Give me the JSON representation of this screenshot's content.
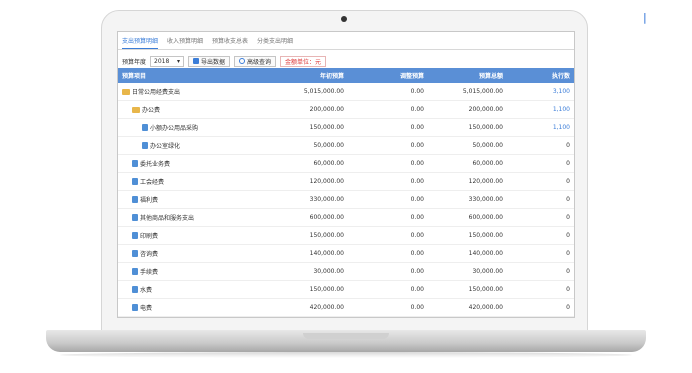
{
  "tabs": [
    "支出预算明细",
    "收入预算明细",
    "预算收支总表",
    "分类支出明细"
  ],
  "toolbar": {
    "year_label": "预算年度",
    "year_value": "2018",
    "export_label": "导出数据",
    "search_label": "高级查询",
    "unit_label": "金额单位：元"
  },
  "columns": [
    "预算项目",
    "年初预算",
    "调整预算",
    "预算总额",
    "执行数"
  ],
  "header_last": "执行数",
  "rows": [
    {
      "name": "日常公用经费支出",
      "icon": "folder-icon",
      "indent": 0,
      "v1": "5,015,000.00",
      "v2": "0.00",
      "v3": "5,015,000.00",
      "v4": "3,100"
    },
    {
      "name": "办公费",
      "icon": "folder-icon",
      "indent": 1,
      "v1": "200,000.00",
      "v2": "0.00",
      "v3": "200,000.00",
      "v4": "1,100"
    },
    {
      "name": "小额办公用品采购",
      "icon": "file-icon",
      "indent": 2,
      "v1": "150,000.00",
      "v2": "0.00",
      "v3": "150,000.00",
      "v4": "1,100"
    },
    {
      "name": "办公室绿化",
      "icon": "file-icon",
      "indent": 2,
      "v1": "50,000.00",
      "v2": "0.00",
      "v3": "50,000.00",
      "v4": "0"
    },
    {
      "name": "委托业务费",
      "icon": "file-icon",
      "indent": 1,
      "v1": "60,000.00",
      "v2": "0.00",
      "v3": "60,000.00",
      "v4": "0"
    },
    {
      "name": "工会经费",
      "icon": "file-icon",
      "indent": 1,
      "v1": "120,000.00",
      "v2": "0.00",
      "v3": "120,000.00",
      "v4": "0"
    },
    {
      "name": "福利费",
      "icon": "file-icon",
      "indent": 1,
      "v1": "330,000.00",
      "v2": "0.00",
      "v3": "330,000.00",
      "v4": "0"
    },
    {
      "name": "其他商品和服务支出",
      "icon": "file-icon",
      "indent": 1,
      "v1": "600,000.00",
      "v2": "0.00",
      "v3": "600,000.00",
      "v4": "0"
    },
    {
      "name": "印刷费",
      "icon": "file-icon",
      "indent": 1,
      "v1": "150,000.00",
      "v2": "0.00",
      "v3": "150,000.00",
      "v4": "0"
    },
    {
      "name": "咨询费",
      "icon": "file-icon",
      "indent": 1,
      "v1": "140,000.00",
      "v2": "0.00",
      "v3": "140,000.00",
      "v4": "0"
    },
    {
      "name": "手续费",
      "icon": "file-icon",
      "indent": 1,
      "v1": "30,000.00",
      "v2": "0.00",
      "v3": "30,000.00",
      "v4": "0"
    },
    {
      "name": "水费",
      "icon": "file-icon",
      "indent": 1,
      "v1": "150,000.00",
      "v2": "0.00",
      "v3": "150,000.00",
      "v4": "0"
    },
    {
      "name": "电费",
      "icon": "file-icon",
      "indent": 1,
      "v1": "420,000.00",
      "v2": "0.00",
      "v3": "420,000.00",
      "v4": "0"
    }
  ],
  "blue_cells": [
    0,
    1,
    2
  ],
  "colors": {
    "header": "#5a8fd6",
    "accent": "#3b7dd8",
    "folder": "#e8b64a",
    "unit_text": "#d33"
  }
}
